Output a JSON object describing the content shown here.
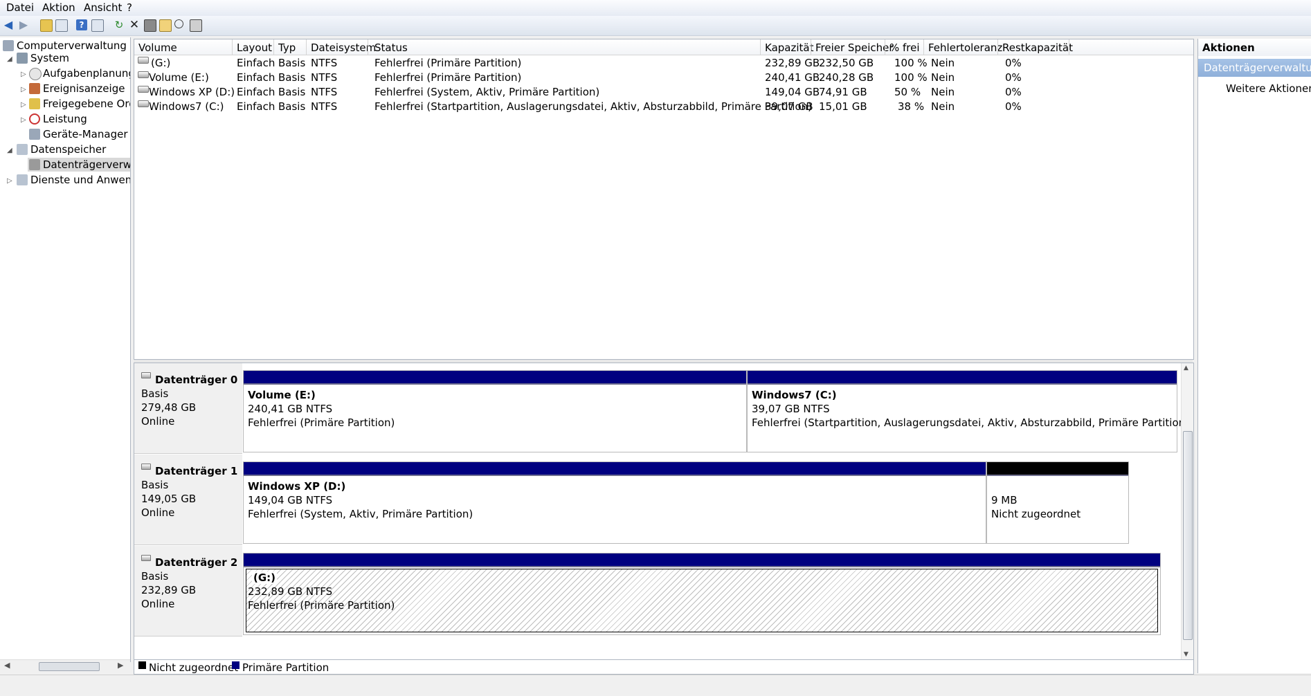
{
  "menu": {
    "file": "Datei",
    "action": "Aktion",
    "view": "Ansicht",
    "help": "?"
  },
  "tree": {
    "root": "Computerverwaltung (Lo",
    "system": "System",
    "task_scheduler": "Aufgabenplanung",
    "event_viewer": "Ereignisanzeige",
    "shared_folders": "Freigegebene Ordn",
    "performance": "Leistung",
    "device_manager": "Geräte-Manager",
    "storage": "Datenspeicher",
    "disk_management": "Datenträgerverwalt",
    "services": "Dienste und Anwendu"
  },
  "columns": [
    "Volume",
    "Layout",
    "Typ",
    "Dateisystem",
    "Status",
    "Kapazität",
    "Freier Speicher",
    "% frei",
    "Fehlertoleranz",
    "Restkapazität"
  ],
  "volumes": [
    {
      "volume": "(G:)",
      "layout": "Einfach",
      "type": "Basis",
      "fs": "NTFS",
      "status": "Fehlerfrei (Primäre Partition)",
      "capacity": "232,89 GB",
      "free": "232,50 GB",
      "pct": "100 %",
      "fault": "Nein",
      "overhead": "0%"
    },
    {
      "volume": "Volume (E:)",
      "layout": "Einfach",
      "type": "Basis",
      "fs": "NTFS",
      "status": "Fehlerfrei (Primäre Partition)",
      "capacity": "240,41 GB",
      "free": "240,28 GB",
      "pct": "100 %",
      "fault": "Nein",
      "overhead": "0%"
    },
    {
      "volume": "Windows XP (D:)",
      "layout": "Einfach",
      "type": "Basis",
      "fs": "NTFS",
      "status": "Fehlerfrei (System, Aktiv, Primäre Partition)",
      "capacity": "149,04 GB",
      "free": "74,91 GB",
      "pct": "50 %",
      "fault": "Nein",
      "overhead": "0%"
    },
    {
      "volume": "Windows7 (C:)",
      "layout": "Einfach",
      "type": "Basis",
      "fs": "NTFS",
      "status": "Fehlerfrei (Startpartition, Auslagerungsdatei, Aktiv, Absturzabbild, Primäre Partition)",
      "capacity": "39,07 GB",
      "free": "15,01 GB",
      "pct": "38 %",
      "fault": "Nein",
      "overhead": "0%"
    }
  ],
  "disks": [
    {
      "name": "Datenträger 0",
      "type": "Basis",
      "size": "279,48 GB",
      "state": "Online",
      "partitions": [
        {
          "title": "Volume  (E:)",
          "size": "240,41 GB NTFS",
          "status": "Fehlerfrei (Primäre Partition)"
        },
        {
          "title": "Windows7  (C:)",
          "size": "39,07 GB NTFS",
          "status": "Fehlerfrei (Startpartition, Auslagerungsdatei, Aktiv, Absturzabbild, Primäre Partition)"
        }
      ]
    },
    {
      "name": "Datenträger 1",
      "type": "Basis",
      "size": "149,05 GB",
      "state": "Online",
      "partitions": [
        {
          "title": "Windows XP  (D:)",
          "size": "149,04 GB NTFS",
          "status": "Fehlerfrei (System, Aktiv, Primäre Partition)"
        },
        {
          "title": "",
          "size": "9 MB",
          "status": "Nicht zugeordnet"
        }
      ]
    },
    {
      "name": "Datenträger 2",
      "type": "Basis",
      "size": "232,89 GB",
      "state": "Online",
      "partitions": [
        {
          "title": "(G:)",
          "size": "232,89 GB NTFS",
          "status": "Fehlerfrei (Primäre Partition)"
        }
      ]
    }
  ],
  "legend": {
    "unallocated": "Nicht zugeordnet",
    "primary": "Primäre Partition",
    "unallocated_color": "#000000",
    "primary_color": "#000080"
  },
  "actions": {
    "header": "Aktionen",
    "selected": "Datenträgerverwaltu...",
    "more": "Weitere Aktionen"
  }
}
